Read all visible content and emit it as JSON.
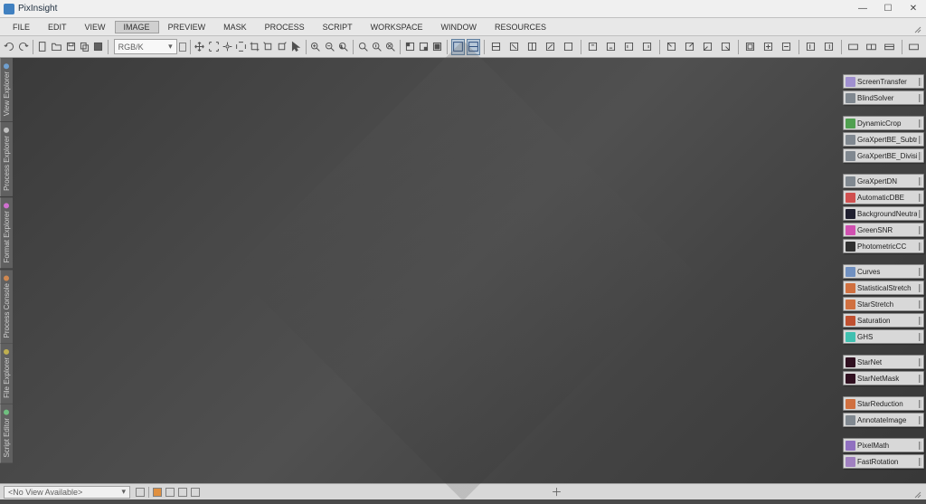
{
  "title": "PixInsight",
  "menus": [
    "FILE",
    "EDIT",
    "VIEW",
    "IMAGE",
    "PREVIEW",
    "MASK",
    "PROCESS",
    "SCRIPT",
    "WORKSPACE",
    "WINDOW",
    "RESOURCES"
  ],
  "menu_active_index": 3,
  "toolbar_dropdown": "RGB/K",
  "left_tabs": [
    {
      "label": "View Explorer",
      "color": "#70a0d0"
    },
    {
      "label": "Process Explorer",
      "color": "#c0c0c0"
    },
    {
      "label": "Format Explorer",
      "color": "#d070d0"
    },
    {
      "label": "Process Console",
      "color": "#d08850"
    },
    {
      "label": "File Explorer",
      "color": "#c0b050"
    },
    {
      "label": "Script Editor",
      "color": "#70c080"
    }
  ],
  "process_groups": [
    [
      {
        "label": "ScreenTransfer",
        "color": "#a090d0"
      },
      {
        "label": "BlindSolver",
        "color": "#808890"
      }
    ],
    [
      {
        "label": "DynamicCrop",
        "color": "#50a050"
      },
      {
        "label": "GraXpertBE_Subtraction",
        "color": "#808890"
      },
      {
        "label": "GraXpertBE_Division",
        "color": "#808890"
      }
    ],
    [
      {
        "label": "GraXpertDN",
        "color": "#808890"
      },
      {
        "label": "AutomaticDBE",
        "color": "#d05050"
      },
      {
        "label": "BackgroundNeutralization",
        "color": "#202030"
      },
      {
        "label": "GreenSNR",
        "color": "#d050b0"
      },
      {
        "label": "PhotometricCC",
        "color": "#303030"
      }
    ],
    [
      {
        "label": "Curves",
        "color": "#7090c0"
      },
      {
        "label": "StatisticalStretch",
        "color": "#d07040"
      },
      {
        "label": "StarStretch",
        "color": "#d07040"
      },
      {
        "label": "Saturation",
        "color": "#c05030"
      },
      {
        "label": "GHS",
        "color": "#40c0b0"
      }
    ],
    [
      {
        "label": "StarNet",
        "color": "#301020"
      },
      {
        "label": "StarNetMask",
        "color": "#301020"
      }
    ],
    [
      {
        "label": "StarReduction",
        "color": "#d07040"
      },
      {
        "label": "AnnotateImage",
        "color": "#808890"
      }
    ],
    [
      {
        "label": "PixelMath",
        "color": "#9070c0"
      },
      {
        "label": "FastRotation",
        "color": "#a080c0"
      }
    ]
  ],
  "status_dropdown": "<No View Available>"
}
